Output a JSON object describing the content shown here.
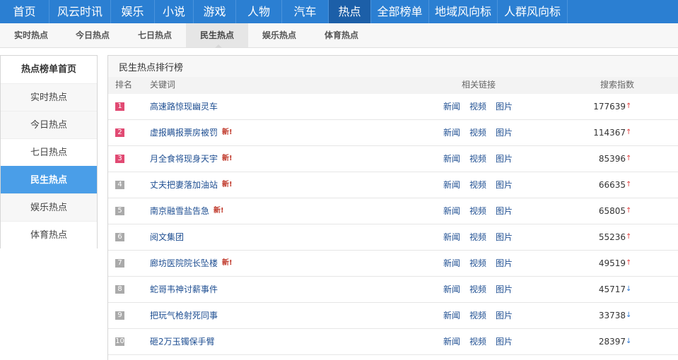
{
  "topnav": [
    {
      "label": "首页",
      "active": false
    },
    {
      "label": "风云时讯",
      "active": false
    },
    {
      "label": "娱乐",
      "active": false
    },
    {
      "label": "小说",
      "active": false
    },
    {
      "label": "游戏",
      "active": false
    },
    {
      "label": "人物",
      "active": false
    },
    {
      "label": "汽车",
      "active": false
    },
    {
      "label": "热点",
      "active": true
    },
    {
      "label": "全部榜单",
      "active": false
    },
    {
      "label": "地域风向标",
      "active": false
    },
    {
      "label": "人群风向标",
      "active": false
    }
  ],
  "subnav": [
    {
      "label": "实时热点",
      "active": false
    },
    {
      "label": "今日热点",
      "active": false
    },
    {
      "label": "七日热点",
      "active": false
    },
    {
      "label": "民生热点",
      "active": true
    },
    {
      "label": "娱乐热点",
      "active": false
    },
    {
      "label": "体育热点",
      "active": false
    }
  ],
  "sidebar": {
    "title": "热点榜单首页",
    "items": [
      {
        "label": "实时热点",
        "active": false
      },
      {
        "label": "今日热点",
        "active": false
      },
      {
        "label": "七日热点",
        "active": false
      },
      {
        "label": "民生热点",
        "active": true
      },
      {
        "label": "娱乐热点",
        "active": false
      },
      {
        "label": "体育热点",
        "active": false
      }
    ]
  },
  "panel": {
    "title": "民生热点排行榜",
    "columns": {
      "rank": "排名",
      "keyword": "关键词",
      "links": "相关链接",
      "index": "搜索指数"
    },
    "link_labels": [
      "新闻",
      "视频",
      "图片"
    ],
    "new_label": "新!",
    "colors": {
      "hot_rank": "#e14a73",
      "cold_rank": "#aaaaaa",
      "trend_up": "#e04040",
      "trend_down": "#2e78d0"
    },
    "rows": [
      {
        "rank": "1",
        "keyword": "高速路惊现幽灵车",
        "is_new": false,
        "index": "177639",
        "trend": "up"
      },
      {
        "rank": "2",
        "keyword": "虚报瞒报票房被罚",
        "is_new": true,
        "index": "114367",
        "trend": "up"
      },
      {
        "rank": "3",
        "keyword": "月全食将现身天宇",
        "is_new": true,
        "index": "85396",
        "trend": "up"
      },
      {
        "rank": "4",
        "keyword": "丈夫把妻落加油站",
        "is_new": true,
        "index": "66635",
        "trend": "up"
      },
      {
        "rank": "5",
        "keyword": "南京融雪盐告急",
        "is_new": true,
        "index": "65805",
        "trend": "up"
      },
      {
        "rank": "6",
        "keyword": "阅文集团",
        "is_new": false,
        "index": "55236",
        "trend": "up"
      },
      {
        "rank": "7",
        "keyword": "廊坊医院院长坠楼",
        "is_new": true,
        "index": "49519",
        "trend": "up"
      },
      {
        "rank": "8",
        "keyword": "蛇哥韦神讨薪事件",
        "is_new": false,
        "index": "45717",
        "trend": "down"
      },
      {
        "rank": "9",
        "keyword": "把玩气枪射死同事",
        "is_new": false,
        "index": "33738",
        "trend": "down"
      },
      {
        "rank": "10",
        "keyword": "砸2万玉镯保手臂",
        "is_new": false,
        "index": "28397",
        "trend": "down"
      }
    ]
  }
}
